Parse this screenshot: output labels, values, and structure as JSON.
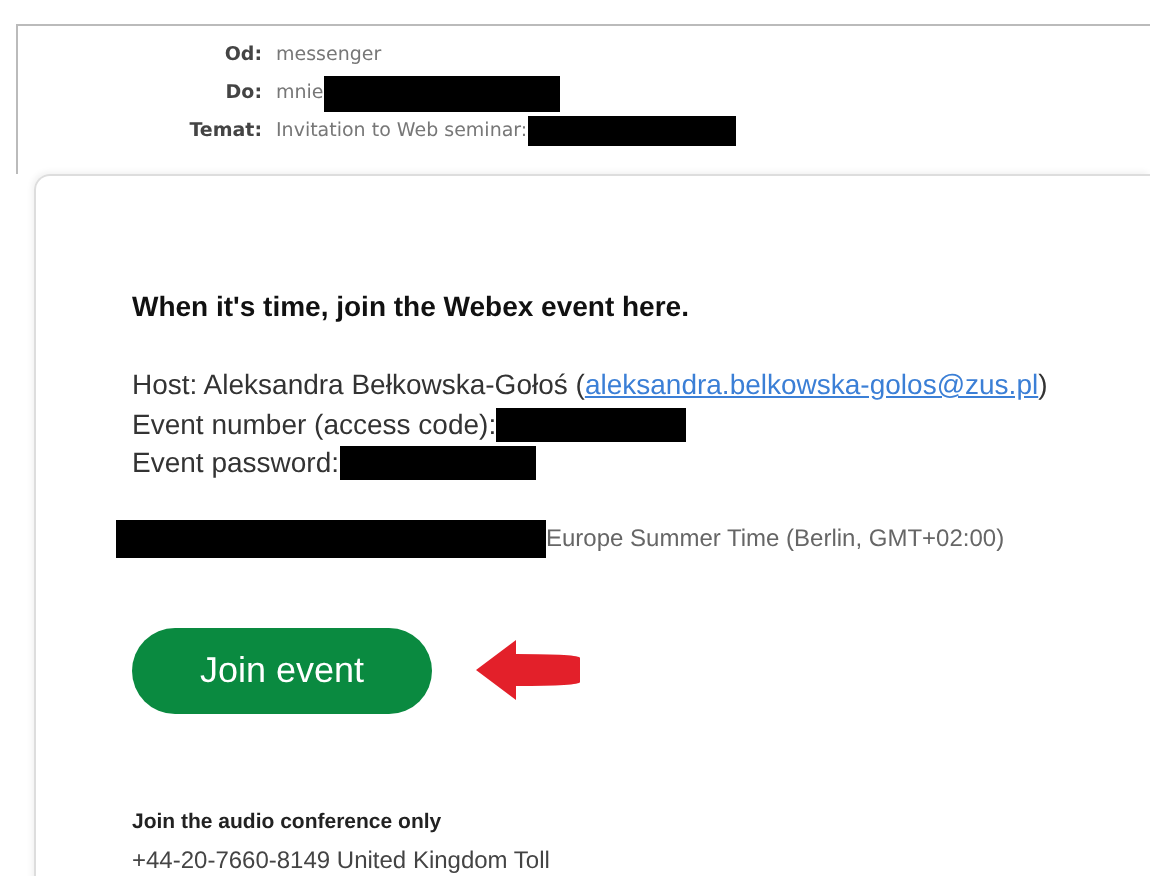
{
  "header": [
    {
      "label": "Od:",
      "value": "messenger",
      "redacted": false
    },
    {
      "label": "Do:",
      "value": "mnie",
      "redacted": true
    },
    {
      "label": "Temat:",
      "value": "Invitation to Web seminar:",
      "redacted": true
    }
  ],
  "body": {
    "heading": "When it's time, join the Webex event here.",
    "host_label": "Host: Aleksandra Bełkowska-Gołoś (",
    "host_email": "aleksandra.belkowska-golos@zus.pl",
    "host_close": ")",
    "event_number_label": "Event number (access code):",
    "event_password_label": "Event password:",
    "timezone": "Europe Summer Time (Berlin, GMT+02:00)",
    "join_button": "Join event",
    "audio_heading": "Join the audio conference only",
    "phone": "+44-20-7660-8149 United Kingdom Toll"
  }
}
